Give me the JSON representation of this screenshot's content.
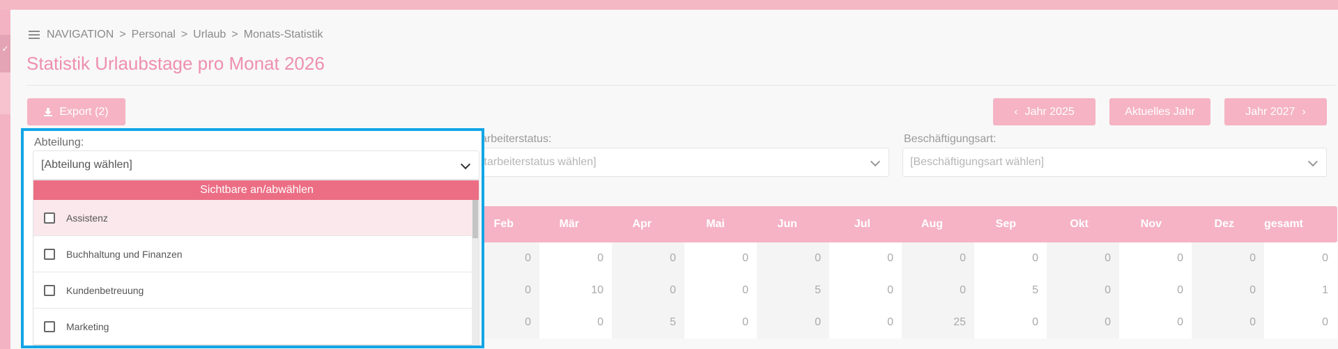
{
  "breadcrumb": {
    "items": [
      "NAVIGATION",
      "Personal",
      "Urlaub",
      "Monats-Statistik"
    ],
    "separator": ">"
  },
  "page": {
    "title": "Statistik Urlaubstage pro Monat 2026"
  },
  "toolbar": {
    "export_label": "Export (2)",
    "prev_year_label": "Jahr 2025",
    "current_year_label": "Aktuelles Jahr",
    "next_year_label": "Jahr 2027"
  },
  "filters": {
    "department": {
      "label": "Abteilung:",
      "value": "[Abteilung wählen]"
    },
    "employee_status": {
      "label": "arbeiterstatus:",
      "placeholder": "itarbeiterstatus wählen]"
    },
    "employment_type": {
      "label": "Beschäftigungsart:",
      "placeholder": "[Beschäftigungsart wählen]"
    }
  },
  "dropdown": {
    "toggle_label": "Sichtbare an/abwählen",
    "options": [
      "Assistenz",
      "Buchhaltung und Finanzen",
      "Kundenbetreuung",
      "Marketing"
    ],
    "highlighted_index": 0
  },
  "table": {
    "headers": [
      "Feb",
      "Mär",
      "Apr",
      "Mai",
      "Jun",
      "Jul",
      "Aug",
      "Sep",
      "Okt",
      "Nov",
      "Dez",
      "gesamt"
    ],
    "rows": [
      [
        "0",
        "0",
        "0",
        "0",
        "0",
        "0",
        "0",
        "0",
        "0",
        "0",
        "0",
        "0"
      ],
      [
        "0",
        "10",
        "0",
        "0",
        "5",
        "0",
        "0",
        "5",
        "0",
        "0",
        "0",
        "1"
      ],
      [
        "0",
        "0",
        "5",
        "0",
        "0",
        "0",
        "25",
        "0",
        "0",
        "0",
        "0",
        "0"
      ]
    ]
  },
  "colors": {
    "accent": "#ee8fae",
    "button": "#f5b3c3",
    "table_header": "#f5b3c5",
    "toggle": "#ec6e84",
    "focus_outline": "#12a5e6"
  },
  "icons": [
    "menu-icon",
    "download-icon",
    "chevron-left-icon",
    "chevron-right-icon",
    "chevron-down-icon",
    "checkbox-icon"
  ]
}
